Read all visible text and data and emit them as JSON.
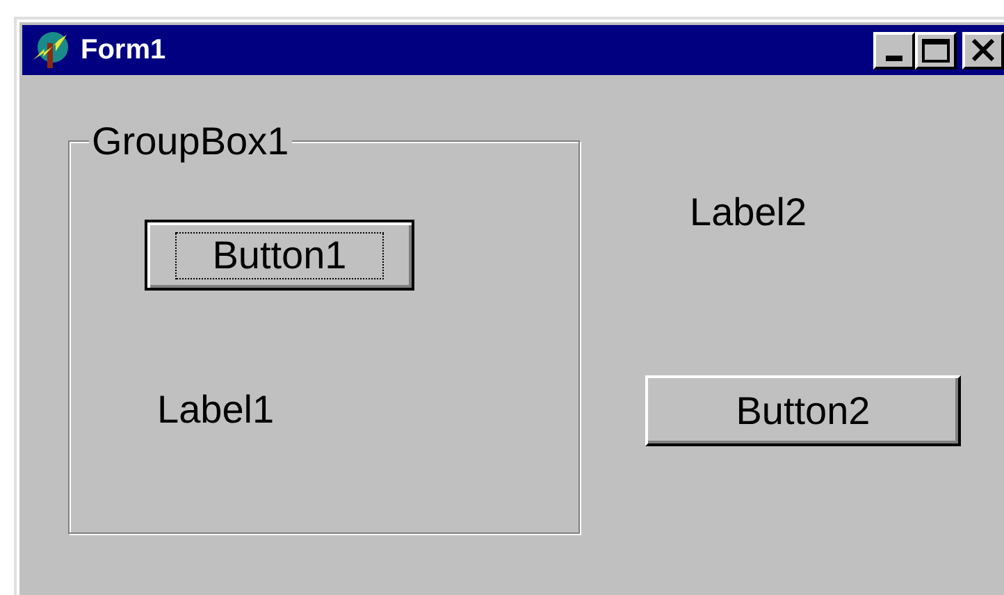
{
  "window": {
    "title": "Form1"
  },
  "group_box": {
    "caption": "GroupBox1"
  },
  "buttons": [
    {
      "label": "Button1",
      "focused": true
    },
    {
      "label": "Button2",
      "focused": false
    }
  ],
  "labels": [
    "Label1",
    "Label2"
  ]
}
